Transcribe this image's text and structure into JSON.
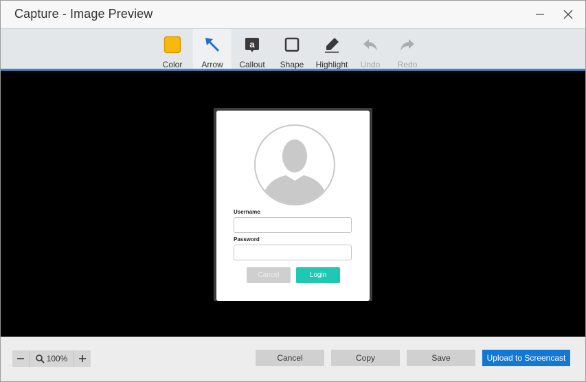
{
  "window": {
    "title": "Capture - Image Preview"
  },
  "toolbar": {
    "accent_color": "#3c86c9",
    "tools": [
      {
        "label": "Color",
        "icon": "color-swatch-icon",
        "swatch": "#f7b90b"
      },
      {
        "label": "Arrow",
        "icon": "arrow-icon",
        "active": true
      },
      {
        "label": "Callout",
        "icon": "callout-icon"
      },
      {
        "label": "Shape",
        "icon": "shape-icon"
      },
      {
        "label": "Highlight",
        "icon": "highlight-icon"
      },
      {
        "label": "Undo",
        "icon": "undo-icon",
        "disabled": true
      },
      {
        "label": "Redo",
        "icon": "redo-icon",
        "disabled": true
      }
    ]
  },
  "preview": {
    "username_label": "Username",
    "password_label": "Password",
    "cancel_label": "Cancel",
    "login_label": "Login",
    "login_color": "#1ec8b3"
  },
  "bottom": {
    "zoom_level": "100%",
    "cancel_label": "Cancel",
    "copy_label": "Copy",
    "save_label": "Save",
    "upload_label": "Upload to Screencast",
    "upload_color": "#1377d3"
  }
}
